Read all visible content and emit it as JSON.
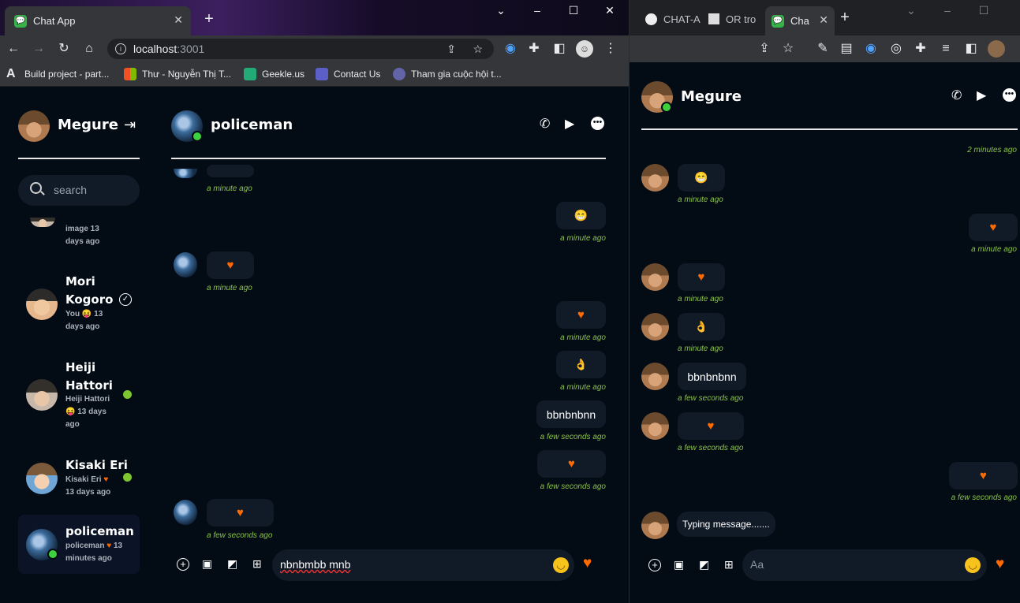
{
  "left_browser": {
    "tab_title": "Chat App",
    "url_host": "localhost",
    "url_port": ":3001",
    "bookmarks": [
      "Build project - part...",
      "Thư - Nguyễn Thị T...",
      "Geekle.us",
      "Contact Us",
      "Tham gia cuộc hội t..."
    ]
  },
  "right_browser": {
    "tabs": [
      "CHAT-A",
      "OR tro",
      "Cha"
    ]
  },
  "left_app": {
    "sidebar": {
      "user_name": "Megure",
      "search_placeholder": "search",
      "partial_item": {
        "line1": "image 13",
        "line2": "days ago"
      },
      "contacts": [
        {
          "name1": "Mori",
          "name2": "Kogoro",
          "meta1": "You 😝 13",
          "meta2": "days ago"
        },
        {
          "name1": "Heiji",
          "name2": "Hattori",
          "meta1": "Heiji Hattori",
          "meta2": "😝 13 days",
          "meta3": "ago"
        },
        {
          "name1": "Kisaki Eri",
          "meta1": "Kisaki Eri",
          "meta2": "13 days ago"
        },
        {
          "name1": "policeman",
          "meta1": "policeman",
          "meta1b": "13",
          "meta2": "minutes ago"
        }
      ]
    },
    "chat": {
      "partner_name": "policeman",
      "messages": [
        {
          "side": "left",
          "content": "",
          "time": "a minute ago"
        },
        {
          "side": "right",
          "content": "😁",
          "time": "a minute ago"
        },
        {
          "side": "left",
          "content": "♥",
          "time": "a minute ago"
        },
        {
          "side": "right",
          "content": "♥",
          "time": "a minute ago"
        },
        {
          "side": "right",
          "content": "👌",
          "time": "a minute ago"
        },
        {
          "side": "right",
          "content": "bbnbnbnn",
          "time": "a few seconds ago"
        },
        {
          "side": "right",
          "content": "♥",
          "time": "a few seconds ago"
        },
        {
          "side": "left",
          "content": "♥",
          "time": "a few seconds ago"
        }
      ],
      "input_value": "nbnbmbb mnb"
    }
  },
  "right_app": {
    "header_name": "Megure",
    "messages": [
      {
        "side": "right",
        "content": "",
        "time": "2 minutes ago"
      },
      {
        "side": "left",
        "content": "😁",
        "time": "a minute ago"
      },
      {
        "side": "right",
        "content": "♥",
        "time": "a minute ago"
      },
      {
        "side": "left",
        "content": "♥",
        "time": "a minute ago"
      },
      {
        "side": "left",
        "content": "👌",
        "time": "a minute ago"
      },
      {
        "side": "left",
        "content": "bbnbnbnn",
        "time": "a few seconds ago"
      },
      {
        "side": "left",
        "content": "♥",
        "time": "a few seconds ago"
      },
      {
        "side": "right",
        "content": "♥",
        "time": "a few seconds ago"
      }
    ],
    "typing_text": "Typing message.......",
    "input_placeholder": "Aa"
  },
  "colors": {
    "background": "#030b14",
    "bubble": "#111b28",
    "accent_heart": "#ff6a00",
    "time_green": "#8bc34a",
    "online": "#3dd23d"
  },
  "icons": [
    "phone-icon",
    "video-icon",
    "more-icon",
    "logout-icon",
    "search-icon",
    "plus-circle-icon",
    "image-icon",
    "sticker-icon",
    "gift-icon",
    "emoji-icon",
    "heart-icon"
  ]
}
